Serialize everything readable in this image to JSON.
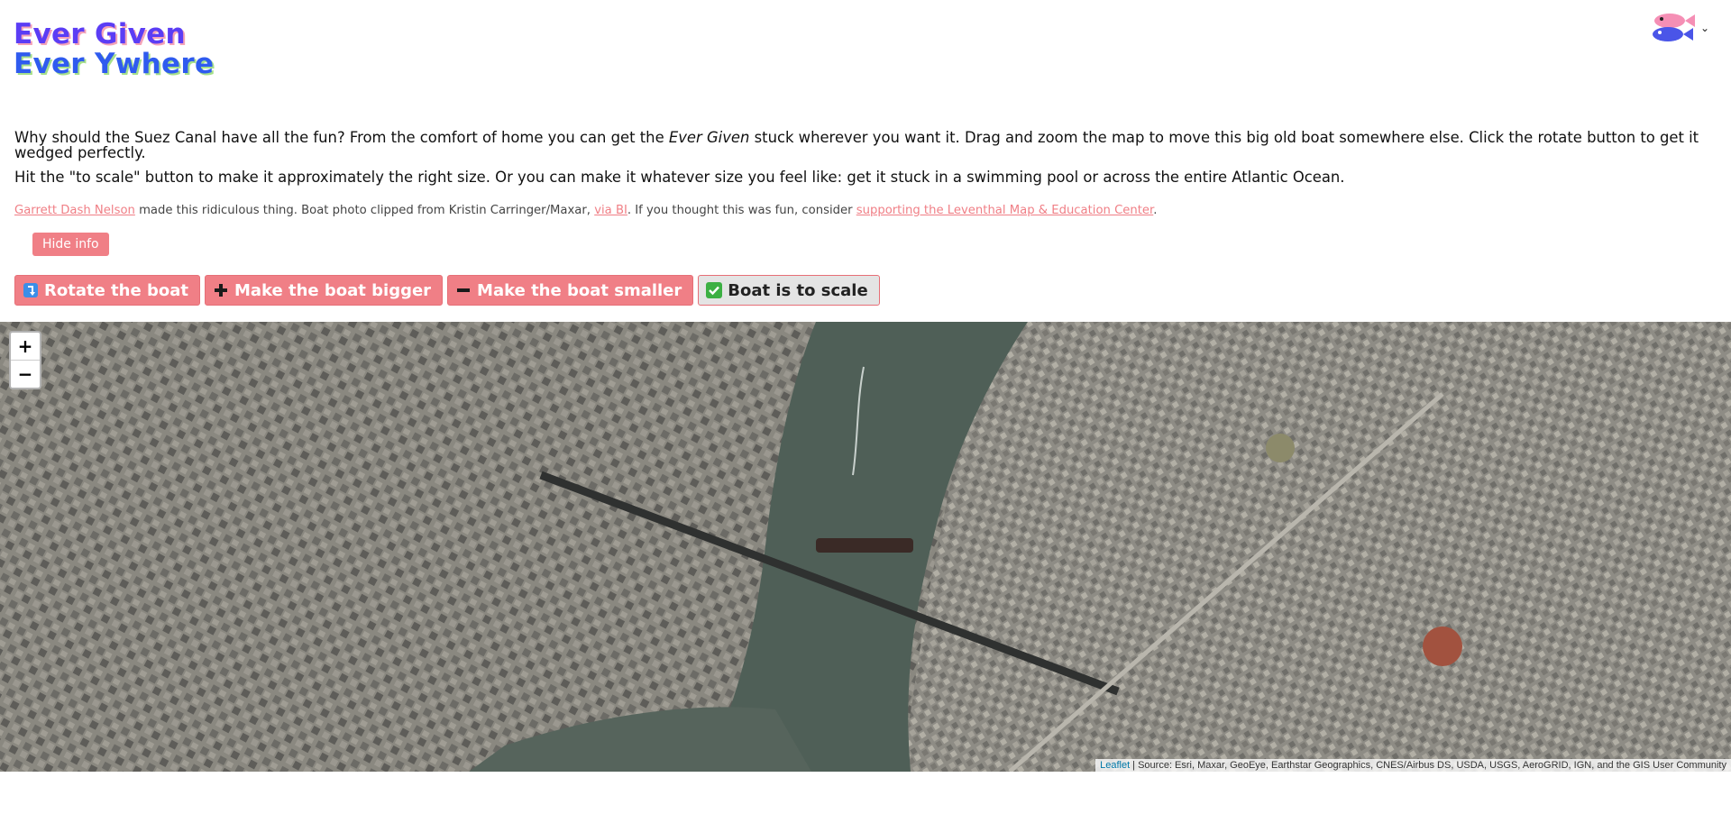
{
  "header": {
    "title_line1": "Ever Given",
    "title_line2": "Ever Ywhere"
  },
  "intro": {
    "p1_before": "Why should the Suez Canal have all the fun? From the comfort of home you can get the ",
    "p1_em": "Ever Given",
    "p1_after": " stuck wherever you want it. Drag and zoom the map to move this big old boat somewhere else. Click the rotate button to get it wedged perfectly.",
    "p2": "Hit the \"to scale\" button to make it approximately the right size. Or you can make it whatever size you feel like: get it stuck in a swimming pool or across the entire Atlantic Ocean."
  },
  "credits": {
    "author_link": "Garrett Dash Nelson",
    "text1": " made this ridiculous thing. Boat photo clipped from Kristin Carringer/Maxar, ",
    "via_link": "via BI",
    "text2": ". If you thought this was fun, consider ",
    "support_link": "supporting the Leventhal Map & Education Center",
    "text3": "."
  },
  "buttons": {
    "hide_info": "Hide info",
    "rotate": "Rotate the boat",
    "bigger": "Make the boat bigger",
    "smaller": "Make the boat smaller",
    "scale": "Boat is to scale"
  },
  "icons": {
    "rotate": "rotate-arrow-icon",
    "bigger": "plus-icon",
    "smaller": "minus-icon",
    "scale": "checkmark-icon",
    "logo": "fish-logo-icon",
    "menu": "chevron-down-icon"
  },
  "map": {
    "zoom_in": "+",
    "zoom_out": "−",
    "attribution_link": "Leaflet",
    "attribution_text": " | Source: Esri, Maxar, GeoEye, Earthstar Geographics, CNES/Airbus DS, USDA, USGS, AeroGRID, IGN, and the GIS User Community"
  },
  "colors": {
    "accent": "#f07f86",
    "title1": "#5b3df5",
    "title2": "#2f5bef"
  }
}
